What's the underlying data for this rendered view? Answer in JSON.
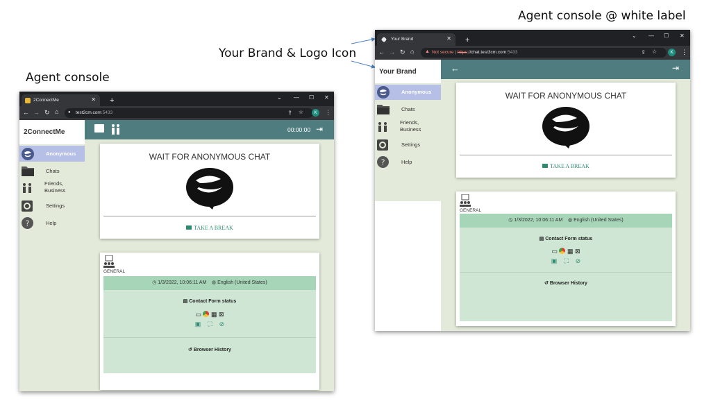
{
  "captions": {
    "left": "Agent console",
    "right": "Agent console @ white label",
    "middle": "Your Brand & Logo Icon"
  },
  "left": {
    "tab_title": "2ConnectMe",
    "url_host": "test2cm.com",
    "url_port": ":5433",
    "avatar": "K",
    "brand": "2ConnectMe",
    "timer": "00:00:00",
    "menu": [
      {
        "label": "Anonymous",
        "icon": "anonymous-icon"
      },
      {
        "label": "Chats",
        "icon": "folder-icon"
      },
      {
        "label": "Friends,\nBusiness",
        "icon": "people-icon"
      },
      {
        "label": "Settings",
        "icon": "gear-icon"
      },
      {
        "label": "Help",
        "icon": "help-icon"
      }
    ]
  },
  "right": {
    "tab_title": "Your Brand",
    "not_secure": "Not secure",
    "url_scheme": "https",
    "url_rest": "://chat.test3cm.com",
    "url_port": ":5433",
    "avatar": "K",
    "brand": "Your Brand",
    "menu": [
      {
        "label": "Anonymous",
        "icon": "anonymous-icon"
      },
      {
        "label": "Chats",
        "icon": "folder-icon"
      },
      {
        "label": "Friends,\nBusiness",
        "icon": "people-icon"
      },
      {
        "label": "Settings",
        "icon": "gear-icon"
      },
      {
        "label": "Help",
        "icon": "help-icon"
      }
    ]
  },
  "content": {
    "wait_title": "WAIT FOR ANONYMOUS CHAT",
    "take_break": "TAKE A BREAK",
    "general": "GENERAL",
    "datetime": "1/3/2022, 10:06:11 AM",
    "language": "English (United States)",
    "contact_status": "Contact Form status",
    "browser_history": "Browser History"
  },
  "colors": {
    "topbar": "#4e7c7f",
    "active_menu": "#b6bfe6",
    "menu_bg": "#e3ead9",
    "green_strip": "#a6d5b8",
    "light_green": "#cfe6d5",
    "accent": "#2e8b72"
  }
}
